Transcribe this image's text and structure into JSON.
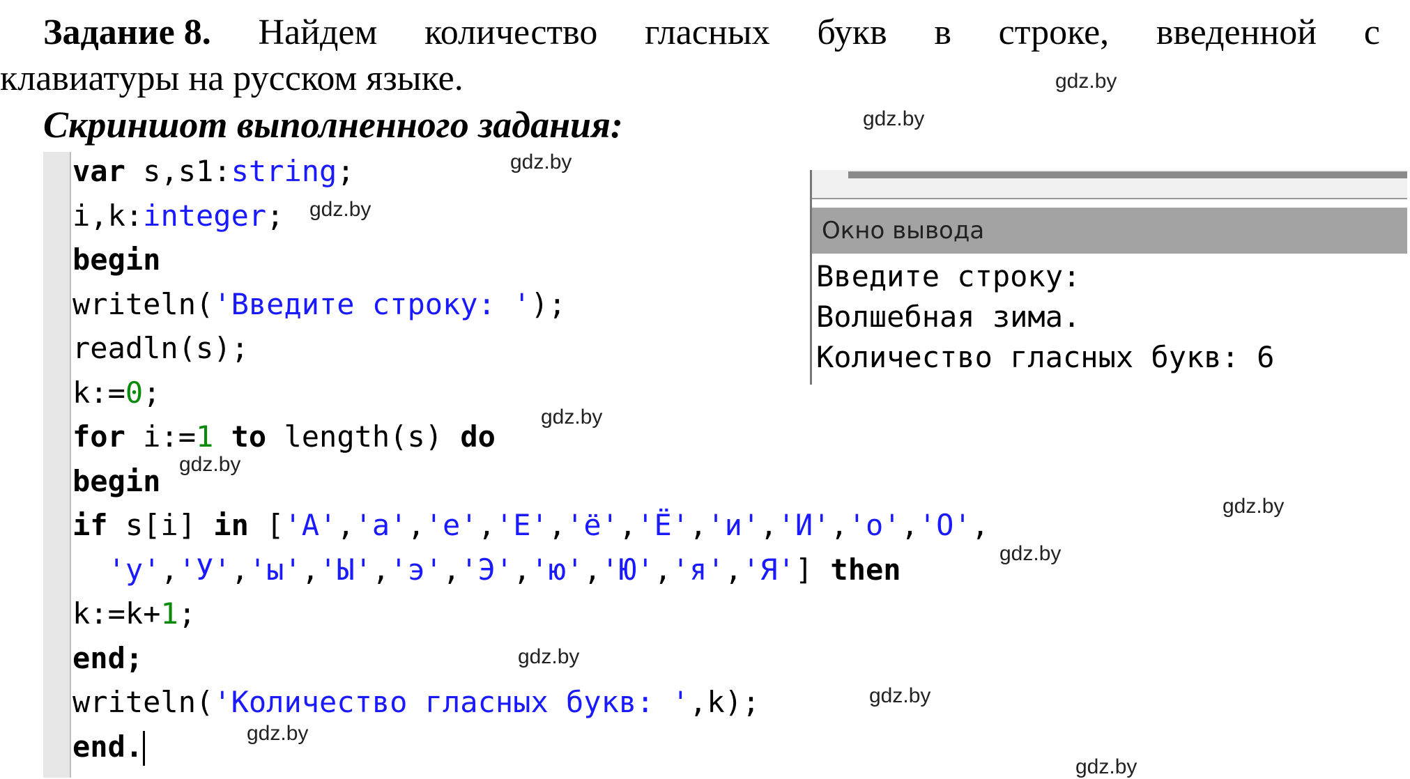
{
  "task": {
    "label": "Задание 8.",
    "line1_words": [
      "Найдем",
      "количество",
      "гласных",
      "букв",
      "в",
      "строке,",
      "введенной",
      "с"
    ],
    "line2": "клавиатуры на русском языке."
  },
  "subtitle": "Скриншот выполненного задания:",
  "code": [
    [
      [
        "var ",
        "kw"
      ],
      [
        "s,s1:",
        "pl"
      ],
      [
        "string",
        "ty"
      ],
      [
        ";",
        "pl"
      ]
    ],
    [
      [
        "i,k:",
        "pl"
      ],
      [
        "integer",
        "ty"
      ],
      [
        ";",
        "pl"
      ]
    ],
    [
      [
        "begin",
        "kw"
      ]
    ],
    [
      [
        "writeln(",
        "pl"
      ],
      [
        "'Введите строку: '",
        "st"
      ],
      [
        ");",
        "pl"
      ]
    ],
    [
      [
        "readln(s);",
        "pl"
      ]
    ],
    [
      [
        "k:=",
        "pl"
      ],
      [
        "0",
        "nu"
      ],
      [
        ";",
        "pl"
      ]
    ],
    [
      [
        "for ",
        "kw"
      ],
      [
        "i:=",
        "pl"
      ],
      [
        "1",
        "nu"
      ],
      [
        " to ",
        "kw"
      ],
      [
        "length(s) ",
        "pl"
      ],
      [
        "do",
        "kw"
      ]
    ],
    [
      [
        "begin",
        "kw"
      ]
    ],
    [
      [
        "if ",
        "kw"
      ],
      [
        "s[i] ",
        "pl"
      ],
      [
        "in ",
        "kw"
      ],
      [
        "[",
        "pl"
      ],
      [
        "'А'",
        "st"
      ],
      [
        ",",
        "pl"
      ],
      [
        "'а'",
        "st"
      ],
      [
        ",",
        "pl"
      ],
      [
        "'е'",
        "st"
      ],
      [
        ",",
        "pl"
      ],
      [
        "'Е'",
        "st"
      ],
      [
        ",",
        "pl"
      ],
      [
        "'ё'",
        "st"
      ],
      [
        ",",
        "pl"
      ],
      [
        "'Ё'",
        "st"
      ],
      [
        ",",
        "pl"
      ],
      [
        "'и'",
        "st"
      ],
      [
        ",",
        "pl"
      ],
      [
        "'И'",
        "st"
      ],
      [
        ",",
        "pl"
      ],
      [
        "'о'",
        "st"
      ],
      [
        ",",
        "pl"
      ],
      [
        "'О'",
        "st"
      ],
      [
        ",",
        "pl"
      ]
    ],
    [
      [
        "  ",
        "pl"
      ],
      [
        "'у'",
        "st"
      ],
      [
        ",",
        "pl"
      ],
      [
        "'У'",
        "st"
      ],
      [
        ",",
        "pl"
      ],
      [
        "'ы'",
        "st"
      ],
      [
        ",",
        "pl"
      ],
      [
        "'Ы'",
        "st"
      ],
      [
        ",",
        "pl"
      ],
      [
        "'э'",
        "st"
      ],
      [
        ",",
        "pl"
      ],
      [
        "'Э'",
        "st"
      ],
      [
        ",",
        "pl"
      ],
      [
        "'ю'",
        "st"
      ],
      [
        ",",
        "pl"
      ],
      [
        "'Ю'",
        "st"
      ],
      [
        ",",
        "pl"
      ],
      [
        "'я'",
        "st"
      ],
      [
        ",",
        "pl"
      ],
      [
        "'Я'",
        "st"
      ],
      [
        "] ",
        "pl"
      ],
      [
        "then",
        "kw"
      ]
    ],
    [
      [
        "k:=k+",
        "pl"
      ],
      [
        "1",
        "nu"
      ],
      [
        ";",
        "pl"
      ]
    ],
    [
      [
        "end;",
        "kw"
      ]
    ],
    [
      [
        "writeln(",
        "pl"
      ],
      [
        "'Количество гласных букв: '",
        "st"
      ],
      [
        ",k);",
        "pl"
      ]
    ],
    [
      [
        "end.",
        "kw"
      ]
    ]
  ],
  "output": {
    "title": "Окно вывода",
    "lines": [
      "Введите строку:",
      "Волшебная зима.",
      "Количество гласных букв: 6"
    ]
  },
  "watermark": "gdz.by"
}
